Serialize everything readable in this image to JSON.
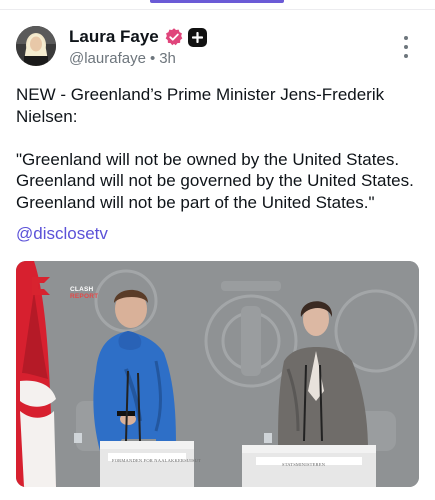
{
  "post": {
    "author": {
      "display_name": "Laura Faye",
      "handle": "@laurafaye",
      "separator": "•",
      "time": "3h"
    },
    "text_lines": [
      "NEW - Greenland’s Prime Minister Jens-Frederik Nielsen:",
      "\"Greenland will not be owned by the United States. Greenland will not be governed by the United States. Greenland will not be part of the United States.\""
    ],
    "link_handle": "@disclosetv",
    "media": {
      "logo_line1": "CLASH",
      "logo_line2": "REPORT",
      "lectern_left_label": "FORMANDEN FOR NAALAKKERSUISUT",
      "lectern_right_label": "STATSMINISTEREN"
    }
  },
  "colors": {
    "accent": "#5b51d8",
    "verified": "#e0457b",
    "muted": "#6e767d"
  },
  "icons": {
    "verified": "verified-badge-icon",
    "subscriber": "plus-badge-icon",
    "more": "more-vertical-icon"
  }
}
